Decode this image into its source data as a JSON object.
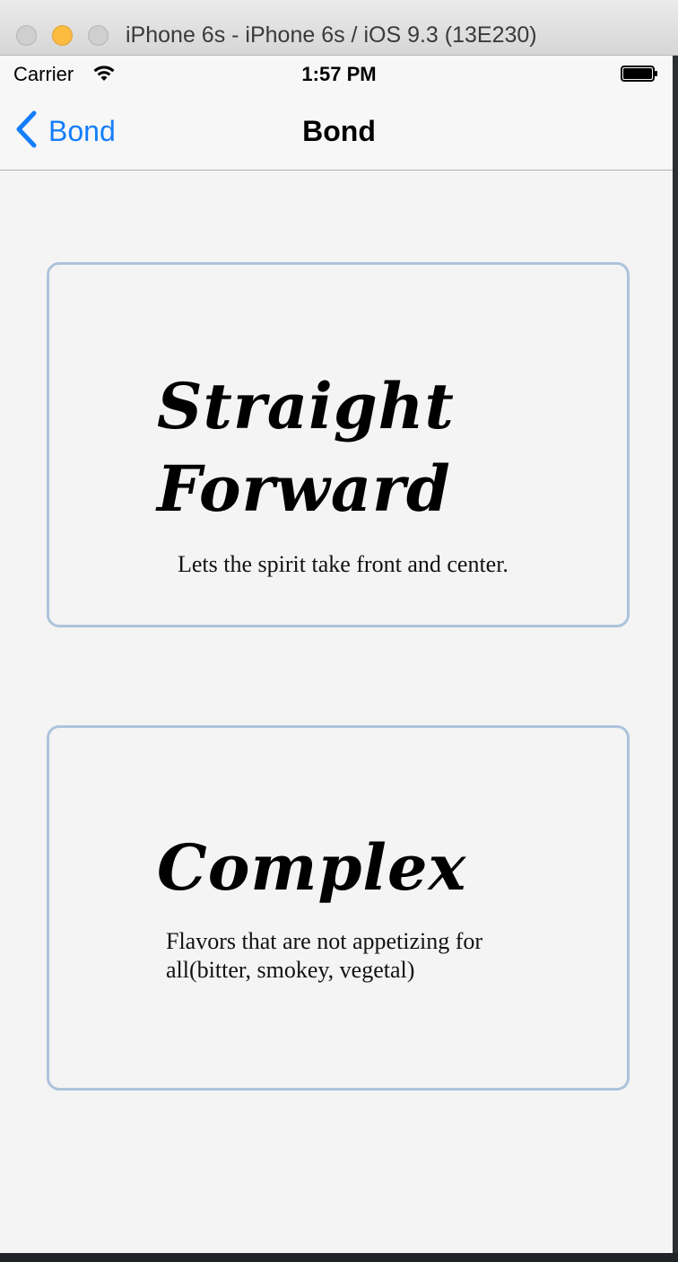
{
  "window": {
    "title": "iPhone 6s - iPhone 6s / iOS 9.3 (13E230)"
  },
  "status_bar": {
    "carrier": "Carrier",
    "time": "1:57 PM"
  },
  "nav_bar": {
    "back_label": "Bond",
    "title": "Bond"
  },
  "cards": [
    {
      "heading": "Straight Forward",
      "description": "Lets the spirit take front and center."
    },
    {
      "heading": "Complex",
      "description": "Flavors that are not appetizing for all(bitter, smokey, vegetal)"
    }
  ],
  "colors": {
    "accent": "#147efb",
    "card_border": "#adc3dc",
    "background": "#f4f4f4"
  },
  "icons": {
    "back": "chevron-left-icon",
    "wifi": "wifi-icon",
    "battery": "battery-icon"
  }
}
